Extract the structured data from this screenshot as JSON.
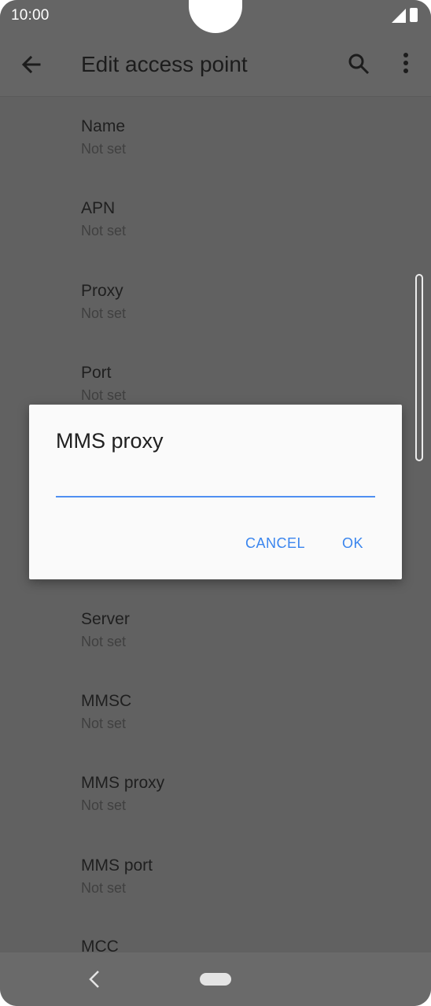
{
  "status": {
    "time": "10:00"
  },
  "appbar": {
    "title": "Edit access point"
  },
  "list": [
    {
      "label": "Name",
      "value": "Not set"
    },
    {
      "label": "APN",
      "value": "Not set"
    },
    {
      "label": "Proxy",
      "value": "Not set"
    },
    {
      "label": "Port",
      "value": "Not set"
    },
    {
      "label": "Server",
      "value": "Not set"
    },
    {
      "label": "MMSC",
      "value": "Not set"
    },
    {
      "label": "MMS proxy",
      "value": "Not set"
    },
    {
      "label": "MMS port",
      "value": "Not set"
    },
    {
      "label": "MCC",
      "value": ""
    }
  ],
  "dialog": {
    "title": "MMS proxy",
    "input_value": "",
    "cancel_label": "CANCEL",
    "ok_label": "OK"
  },
  "colors": {
    "accent": "#3a85ee",
    "scrim": "#616161"
  }
}
